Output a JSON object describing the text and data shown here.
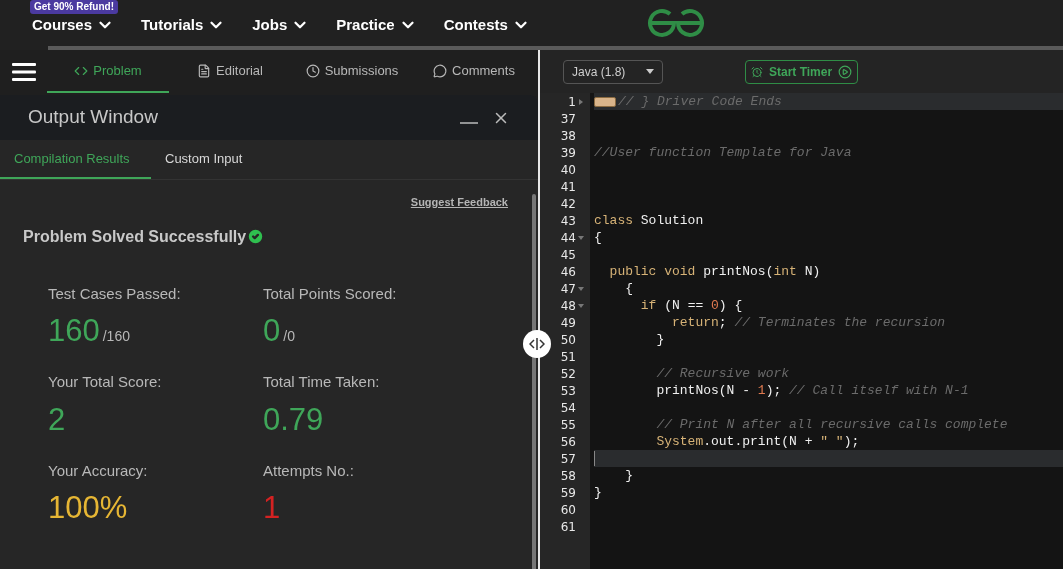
{
  "top_nav": {
    "badge": "Get 90% Refund!",
    "items": [
      "Courses",
      "Tutorials",
      "Jobs",
      "Practice",
      "Contests"
    ]
  },
  "problem_tabs": [
    {
      "label": "Problem",
      "selected": true
    },
    {
      "label": "Editorial",
      "selected": false
    },
    {
      "label": "Submissions",
      "selected": false
    },
    {
      "label": "Comments",
      "selected": false
    }
  ],
  "output_window": {
    "title": "Output Window",
    "tabs": [
      {
        "label": "Compilation Results",
        "selected": true
      },
      {
        "label": "Custom Input",
        "selected": false
      }
    ],
    "feedback_link": "Suggest Feedback",
    "status": "Problem Solved Successfully",
    "stats": [
      {
        "label": "Test Cases Passed:",
        "value": "160",
        "total": "/160",
        "color": "#3fa659"
      },
      {
        "label": "Total Points Scored:",
        "value": "0",
        "total": "/0",
        "color": "#3fa659"
      },
      {
        "label": "Your Total Score:",
        "value": "2",
        "color": "#3fa659"
      },
      {
        "label": "Total Time Taken:",
        "value": "0.79",
        "color": "#3fa659"
      },
      {
        "label": "Your Accuracy:",
        "value": "100%",
        "color": "#e6b634"
      },
      {
        "label": "Attempts No.:",
        "value": "1",
        "color": "#d42222"
      }
    ]
  },
  "editor": {
    "language": "Java (1.8)",
    "timer_button": "Start Timer",
    "lines": [
      {
        "number": "1",
        "foldable": true,
        "folded": true,
        "highlighted": true,
        "tokens": [
          {
            "kind": "comment",
            "text": "// } Driver Code Ends"
          }
        ]
      },
      {
        "number": "37",
        "foldable": false,
        "highlighted": false
      },
      {
        "number": "38",
        "foldable": false,
        "highlighted": false
      },
      {
        "number": "39",
        "foldable": false,
        "highlighted": false,
        "tokens": [
          {
            "kind": "comment",
            "text": "//User function Template for Java"
          }
        ]
      },
      {
        "number": "40",
        "foldable": false,
        "highlighted": false
      },
      {
        "number": "41",
        "foldable": false,
        "highlighted": false
      },
      {
        "number": "42",
        "foldable": false,
        "highlighted": false
      },
      {
        "number": "43",
        "foldable": false,
        "highlighted": false,
        "tokens": [
          {
            "kind": "keyword",
            "text": "class"
          },
          {
            "kind": "plain",
            "text": " Solution"
          }
        ]
      },
      {
        "number": "44",
        "foldable": true,
        "folded": false,
        "highlighted": false,
        "tokens": [
          {
            "kind": "plain",
            "text": "{"
          }
        ]
      },
      {
        "number": "45",
        "foldable": false,
        "highlighted": false
      },
      {
        "number": "46",
        "foldable": false,
        "highlighted": false,
        "tokens": [
          {
            "kind": "keyword",
            "text": "  public void"
          },
          {
            "kind": "plain",
            "text": " printNos("
          },
          {
            "kind": "keyword",
            "text": "int"
          },
          {
            "kind": "plain",
            "text": " N)"
          }
        ]
      },
      {
        "number": "47",
        "foldable": true,
        "folded": false,
        "highlighted": false,
        "tokens": [
          {
            "kind": "plain",
            "text": "    {"
          }
        ]
      },
      {
        "number": "48",
        "foldable": true,
        "folded": false,
        "highlighted": false,
        "tokens": [
          {
            "kind": "keyword",
            "text": "      if"
          },
          {
            "kind": "plain",
            "text": " (N == "
          },
          {
            "kind": "number",
            "text": "0"
          },
          {
            "kind": "plain",
            "text": ") {"
          }
        ]
      },
      {
        "number": "49",
        "foldable": false,
        "highlighted": false,
        "tokens": [
          {
            "kind": "keyword",
            "text": "          return"
          },
          {
            "kind": "plain",
            "text": ";"
          },
          {
            "kind": "comment",
            "text": " // Terminates the recursion"
          }
        ]
      },
      {
        "number": "50",
        "foldable": false,
        "highlighted": false,
        "tokens": [
          {
            "kind": "plain",
            "text": "        }"
          }
        ]
      },
      {
        "number": "51",
        "foldable": false,
        "highlighted": false
      },
      {
        "number": "52",
        "foldable": false,
        "highlighted": false,
        "tokens": [
          {
            "kind": "comment",
            "text": "        // Recursive work"
          }
        ]
      },
      {
        "number": "53",
        "foldable": false,
        "highlighted": false,
        "tokens": [
          {
            "kind": "plain",
            "text": "        printNos(N - "
          },
          {
            "kind": "number",
            "text": "1"
          },
          {
            "kind": "plain",
            "text": ");"
          },
          {
            "kind": "comment",
            "text": " // Call itself with N-1"
          }
        ]
      },
      {
        "number": "54",
        "foldable": false,
        "highlighted": false
      },
      {
        "number": "55",
        "foldable": false,
        "highlighted": false,
        "tokens": [
          {
            "kind": "comment",
            "text": "        // Print N after all recursive calls complete"
          }
        ]
      },
      {
        "number": "56",
        "foldable": false,
        "highlighted": false,
        "tokens": [
          {
            "kind": "keyword",
            "text": "        System"
          },
          {
            "kind": "plain",
            "text": ".out.print(N + "
          },
          {
            "kind": "string",
            "text": "\" \""
          },
          {
            "kind": "plain",
            "text": ");"
          }
        ]
      },
      {
        "number": "57",
        "foldable": false,
        "highlighted": true
      },
      {
        "number": "58",
        "foldable": false,
        "highlighted": false,
        "tokens": [
          {
            "kind": "plain",
            "text": "    }"
          }
        ]
      },
      {
        "number": "59",
        "foldable": false,
        "highlighted": false,
        "tokens": [
          {
            "kind": "plain",
            "text": "}"
          }
        ]
      },
      {
        "number": "60",
        "foldable": false,
        "highlighted": false
      },
      {
        "number": "61",
        "foldable": false,
        "highlighted": false
      }
    ]
  }
}
